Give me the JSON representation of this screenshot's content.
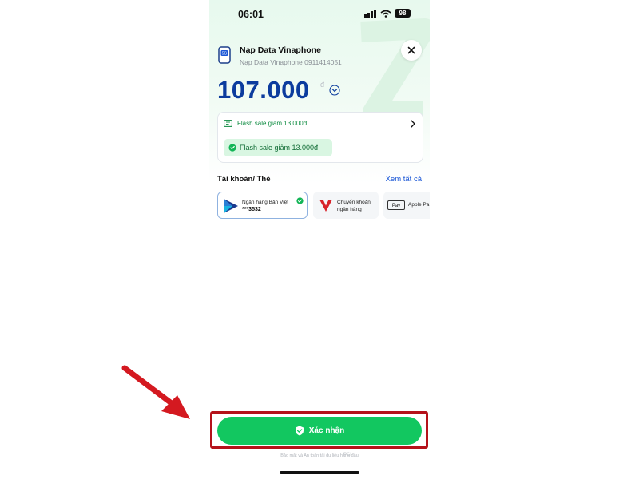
{
  "status_bar": {
    "time": "06:01",
    "battery": "98"
  },
  "header": {
    "title": "Nạp Data Vinaphone",
    "subtitle": "Nạp Data Vinaphone 0911414051",
    "icon_badge": "5G"
  },
  "amount": {
    "value": "107.000",
    "currency": "đ"
  },
  "promo": {
    "row_text": "Flash sale giảm 13.000đ",
    "chip_text": "Flash sale giảm 13.000đ"
  },
  "payment_section": {
    "title": "Tài khoản/ Thẻ",
    "see_all": "Xem tất cả",
    "methods": [
      {
        "name": "Ngân hàng Bản Việt",
        "number": "***3532"
      },
      {
        "name": "Chuyển khoản ngân hàng"
      },
      {
        "badge": "Pay",
        "name": "Apple Pa"
      }
    ]
  },
  "confirm": {
    "label": "Xác nhận"
  },
  "footer": {
    "note": "Bảo mật và An toàn tài du liệu hàng đầu",
    "pci": "PCI"
  },
  "colors": {
    "primary_green": "#12c760",
    "amount_blue": "#0c3c9e",
    "link_blue": "#1a56d6",
    "highlight_red": "#b5121b"
  }
}
